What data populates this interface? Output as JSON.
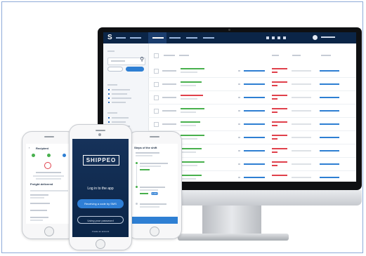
{
  "desktop": {
    "logo_letter": "S"
  },
  "mobile_center": {
    "logo": "SHIPPEO",
    "heading": "Log in to the app",
    "primary_button": "Receiving a code by SMS",
    "secondary_button": "Using your password",
    "footer_link": "Create an account"
  },
  "mobile_left": {
    "title": "Recipient",
    "section_label": "Freight delivered"
  },
  "mobile_right": {
    "title": "Steps of the shift",
    "badge": "Confirm"
  },
  "colors": {
    "navy": "#0b2547",
    "accent_blue": "#2e7fd3",
    "status_green": "#48b04d",
    "status_red": "#e0404b"
  }
}
